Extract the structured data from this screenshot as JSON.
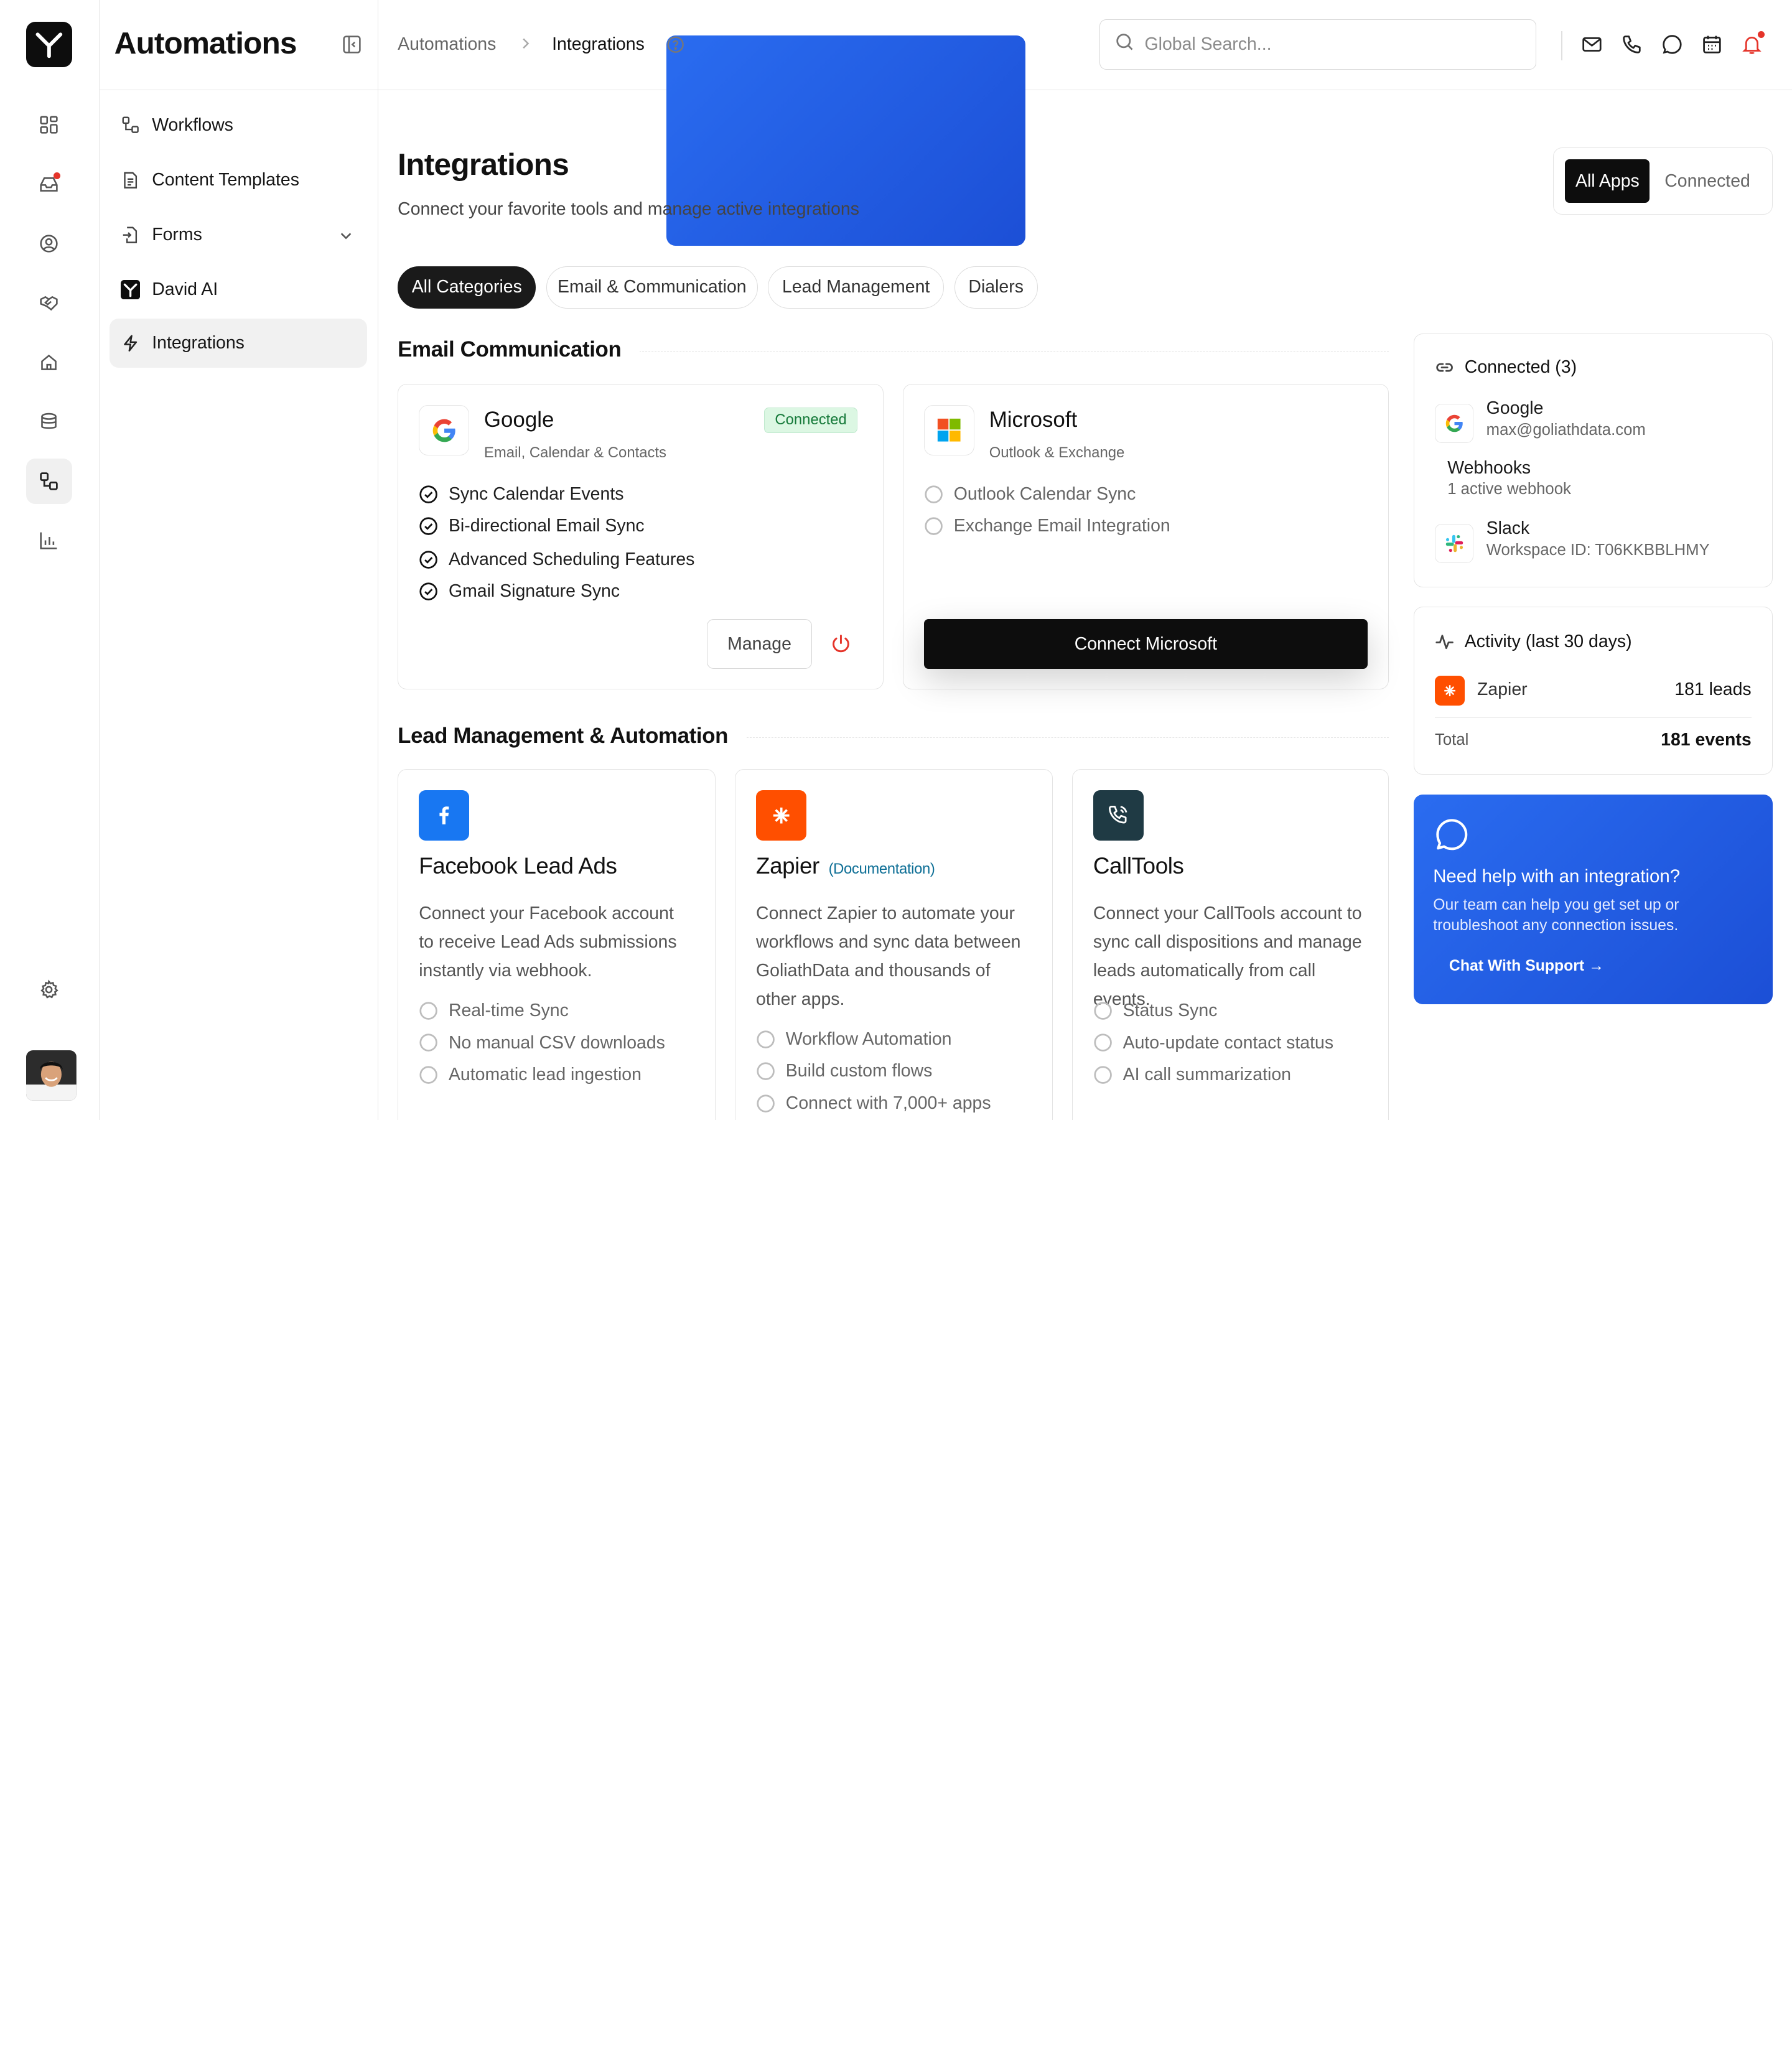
{
  "sidebar": {
    "title": "Automations",
    "items": [
      {
        "label": "Workflows",
        "icon": "workflow-icon"
      },
      {
        "label": "Content Templates",
        "icon": "document-icon"
      },
      {
        "label": "Forms",
        "icon": "form-icon"
      },
      {
        "label": "David AI",
        "icon": "david-ai-logo-icon"
      },
      {
        "label": "Integrations",
        "icon": "zap-icon"
      }
    ]
  },
  "rail": {
    "icons": [
      "dashboard-icon",
      "inbox-icon",
      "contacts-icon",
      "handshake-icon",
      "home-icon",
      "database-icon",
      "automations-icon",
      "analytics-icon",
      "settings-icon"
    ]
  },
  "header": {
    "breadcrumb": [
      "Automations",
      "Integrations"
    ],
    "search_placeholder": "Global Search...",
    "icons": [
      "mail-icon",
      "phone-icon",
      "chat-icon",
      "calendar-icon",
      "bell-icon"
    ]
  },
  "page": {
    "title": "Integrations",
    "subtitle": "Connect your favorite tools and manage active integrations",
    "toggle": {
      "active": "All Apps",
      "inactive": "Connected"
    },
    "filters": [
      "All Categories",
      "Email & Communication",
      "Lead Management",
      "Dialers"
    ]
  },
  "email_section": {
    "title": "Email Communication",
    "google": {
      "name": "Google",
      "desc": "Email, Calendar & Contacts",
      "badge": "Connected",
      "features": [
        "Sync Calendar Events",
        "Bi-directional Email Sync",
        "Advanced Scheduling Features",
        "Gmail Signature Sync"
      ],
      "manage_label": "Manage"
    },
    "microsoft": {
      "name": "Microsoft",
      "desc": "Outlook & Exchange",
      "features": [
        "Outlook Calendar Sync",
        "Exchange Email Integration"
      ],
      "button_label": "Connect Microsoft"
    }
  },
  "lead_section": {
    "title": "Lead Management & Automation",
    "cards": [
      {
        "name": "Facebook Lead Ads",
        "desc": "Connect your Facebook account to receive Lead Ads submissions instantly via webhook.",
        "features": [
          "Real-time Sync",
          "No manual CSV downloads",
          "Automatic lead ingestion"
        ],
        "color": "#1877f2"
      },
      {
        "name": "Zapier",
        "doc": "(Documentation)",
        "desc": "Connect Zapier to automate your workflows and sync data between GoliathData and thousands of other apps.",
        "features": [
          "Workflow Automation",
          "Build custom flows",
          "Connect with 7,000+ apps"
        ],
        "color": "#ff4f00"
      },
      {
        "name": "CallTools",
        "desc": "Connect your CallTools account to sync call dispositions and manage leads automatically from call events.",
        "features": [
          "Status Sync",
          "Auto-update contact status",
          "AI call summarization"
        ],
        "color": "#1f3a44"
      }
    ]
  },
  "connected_panel": {
    "title": "Connected (3)",
    "items": [
      {
        "name": "Google",
        "detail": "max@goliathdata.com"
      },
      {
        "name": "Webhooks",
        "detail": "1 active webhook"
      },
      {
        "name": "Slack",
        "detail": "Workspace ID: T06KKBBLHMY"
      }
    ]
  },
  "activity_panel": {
    "title": "Activity (last 30 days)",
    "row": {
      "name": "Zapier",
      "value": "181 leads"
    },
    "total_label": "Total",
    "total_value": "181 events"
  },
  "help_card": {
    "title": "Need help with an integration?",
    "desc": "Our team can help you get set up or troubleshoot any connection issues.",
    "link": "Chat With Support →"
  }
}
